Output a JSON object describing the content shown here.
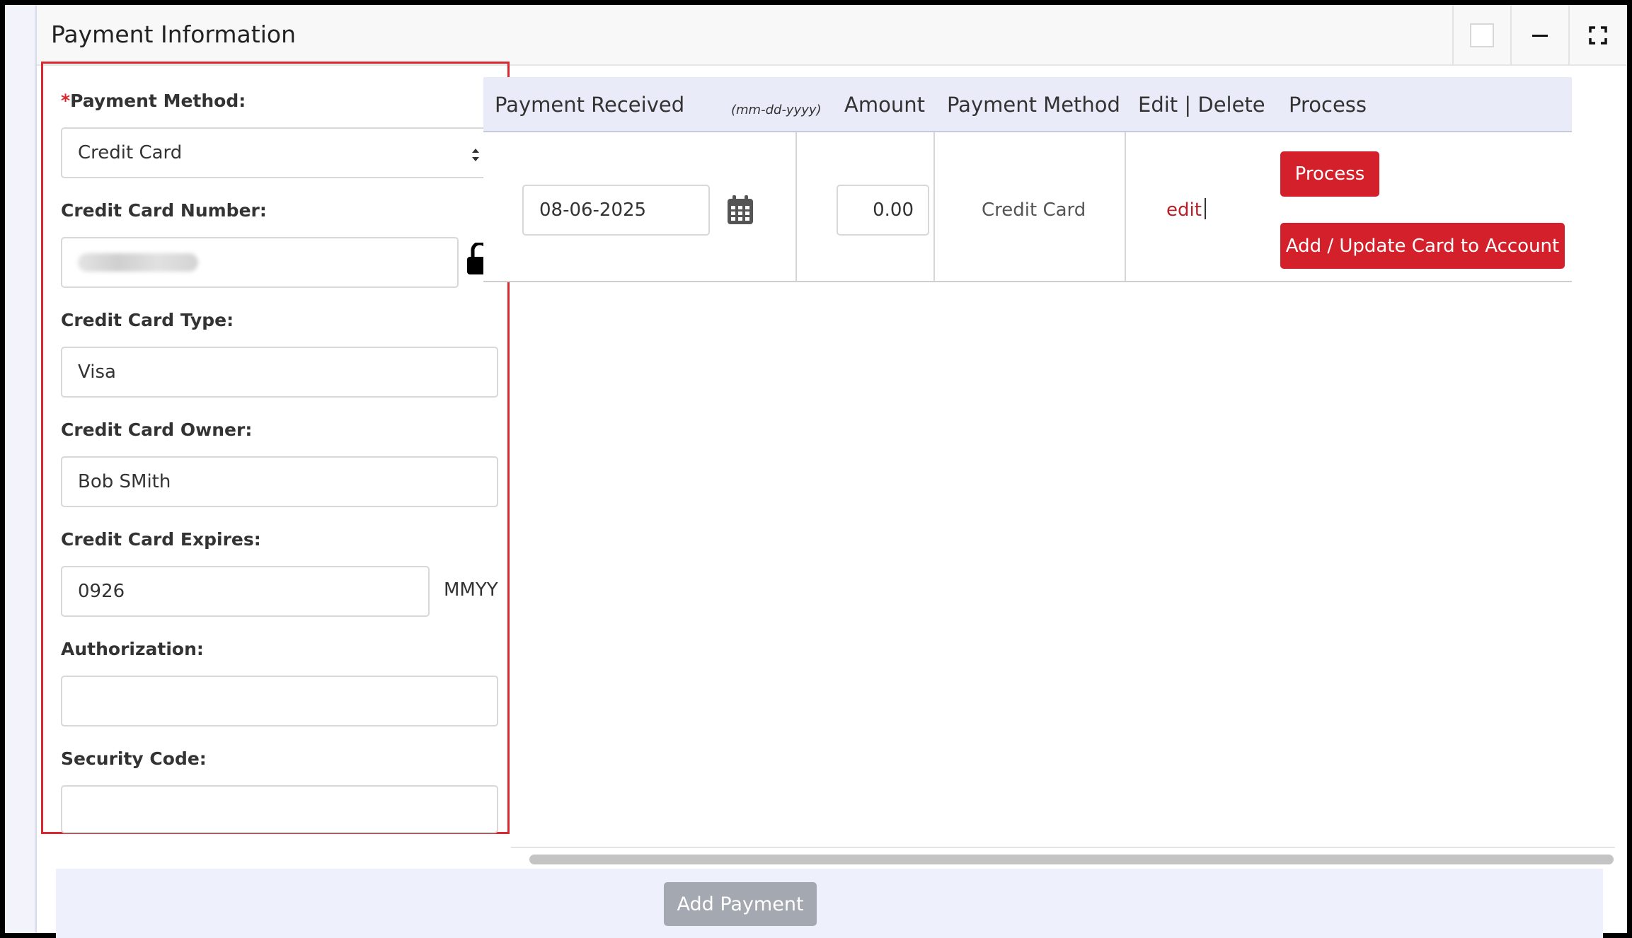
{
  "panel": {
    "title": "Payment Information"
  },
  "form": {
    "payment_method_required": "*",
    "payment_method_label": "Payment Method:",
    "payment_method_value": "Credit Card",
    "cc_number_label": "Credit Card Number:",
    "cc_type_label": "Credit Card Type:",
    "cc_type_value": "Visa",
    "cc_owner_label": "Credit Card Owner:",
    "cc_owner_value": "Bob SMith",
    "cc_expires_label": "Credit Card Expires:",
    "cc_expires_value": "0926",
    "cc_expires_suffix": "MMYY",
    "authorization_label": "Authorization:",
    "authorization_value": "",
    "security_code_label": "Security Code:",
    "security_code_value": ""
  },
  "table": {
    "headers": {
      "payment_received": "Payment Received",
      "date_format": "(mm-dd-yyyy)",
      "amount": "Amount",
      "payment_method": "Payment Method",
      "edit_delete": "Edit | Delete",
      "process": "Process"
    },
    "row": {
      "date": "08-06-2025",
      "amount": "0.00",
      "payment_method": "Credit Card",
      "edit": "edit",
      "process_button": "Process",
      "add_update_button": "Add / Update Card to Account"
    }
  },
  "footer": {
    "add_payment_button": "Add Payment"
  },
  "colors": {
    "accent_red": "#d3202a",
    "highlight_border": "#d9282f",
    "header_bg": "#e9ecf8",
    "disabled_button": "#a4a8b0"
  },
  "icons": [
    "select-arrows-icon",
    "unlock-icon",
    "calendar-icon",
    "checkbox-icon",
    "minimize-icon",
    "maximize-icon"
  ]
}
